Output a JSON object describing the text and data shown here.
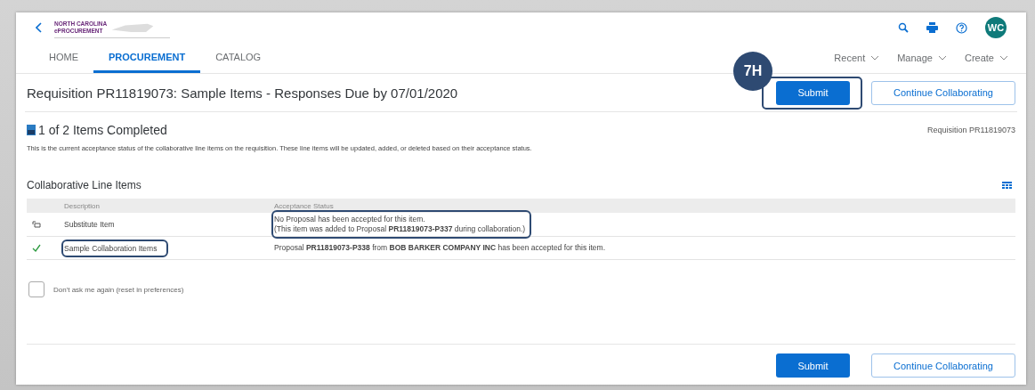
{
  "header": {
    "logo": {
      "line1": "NORTH CAROLINA",
      "line2": "ePROCUREMENT"
    },
    "avatar": "WC"
  },
  "tabs": [
    {
      "label": "HOME",
      "selected": false
    },
    {
      "label": "PROCUREMENT",
      "selected": true
    },
    {
      "label": "CATALOG",
      "selected": false
    }
  ],
  "menus": [
    "Recent",
    "Manage",
    "Create"
  ],
  "page": {
    "title": "Requisition PR11819073: Sample Items - Responses Due by 07/01/2020",
    "step_badge": "7H"
  },
  "actions_top": {
    "submit": {
      "label": "Submit",
      "highlighted": true
    },
    "continue": "Continue Collaborating"
  },
  "summary": {
    "heading": "1 of 2 Items Completed",
    "reference": "Requisition PR11819073",
    "description": "This is the current acceptance status of the collaborative line items on the requisition. These line items will be updated, added, or deleted based on their acceptance status."
  },
  "table": {
    "title": "Collaborative Line Items",
    "columns": [
      "Description",
      "Acceptance Status"
    ],
    "rows": [
      {
        "kind": "substitute",
        "description": "Substitute Item",
        "description_highlighted": false,
        "status": [
          "No Proposal has been accepted for this item.",
          "(This item was added to Proposal **PR11819073-P337** during collaboration.)"
        ],
        "status_highlighted": true
      },
      {
        "kind": "accepted",
        "description": "Sample Collaboration Items",
        "description_highlighted": true,
        "status": [
          "Proposal **PR11819073-P338** from **BOB BARKER COMPANY INC** has been accepted for this item."
        ],
        "status_highlighted": false
      }
    ]
  },
  "dont_ask": {
    "label": "Don't ask me again (reset in preferences)",
    "checked": false
  },
  "actions_bottom": {
    "submit": {
      "label": "Submit",
      "highlighted": false
    },
    "continue": "Continue Collaborating"
  }
}
